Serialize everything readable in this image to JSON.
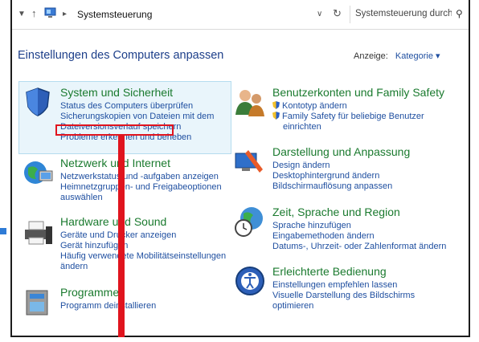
{
  "address_bar": {
    "path": "Systemsteuerung",
    "search_placeholder": "Systemsteuerung durchsuchen"
  },
  "page_title": "Einstellungen des Computers anpassen",
  "view": {
    "label": "Anzeige:",
    "selected": "Kategorie ▾"
  },
  "categories": [
    {
      "title": "System und Sicherheit",
      "links": [
        "Status des Computers überprüfen",
        "Sicherungskopien von Dateien mit dem",
        "Dateiversionsverlauf speichern",
        "Probleme erkennen und beheben"
      ]
    },
    {
      "title": "Netzwerk und Internet",
      "links": [
        "Netzwerkstatus und -aufgaben anzeigen",
        "Heimnetzgruppen- und Freigabeoptionen",
        "auswählen"
      ]
    },
    {
      "title": "Hardware und Sound",
      "links": [
        "Geräte und Drucker anzeigen",
        "Gerät hinzufügen",
        "Häufig verwendete Mobilitätseinstellungen",
        "ändern"
      ]
    },
    {
      "title": "Programme",
      "links": [
        "Programm deinstallieren"
      ]
    },
    {
      "title": "Benutzerkonten und Family Safety",
      "links": [
        "Kontotyp ändern",
        "Family Safety für beliebige Benutzer",
        "einrichten"
      ]
    },
    {
      "title": "Darstellung und Anpassung",
      "links": [
        "Design ändern",
        "Desktophintergrund ändern",
        "Bildschirmauflösung anpassen"
      ]
    },
    {
      "title": "Zeit, Sprache und Region",
      "links": [
        "Sprache hinzufügen",
        "Eingabemethoden ändern",
        "Datums-, Uhrzeit- oder Zahlenformat ändern"
      ]
    },
    {
      "title": "Erleichterte Bedienung",
      "links": [
        "Einstellungen empfehlen lassen",
        "Visuelle Darstellung des Bildschirms",
        "optimieren"
      ]
    }
  ],
  "colors": {
    "heading": "#1a7a2e",
    "link": "#1f4fa0",
    "annotation": "#e0141e",
    "hover_bg": "#e9f5fb"
  }
}
